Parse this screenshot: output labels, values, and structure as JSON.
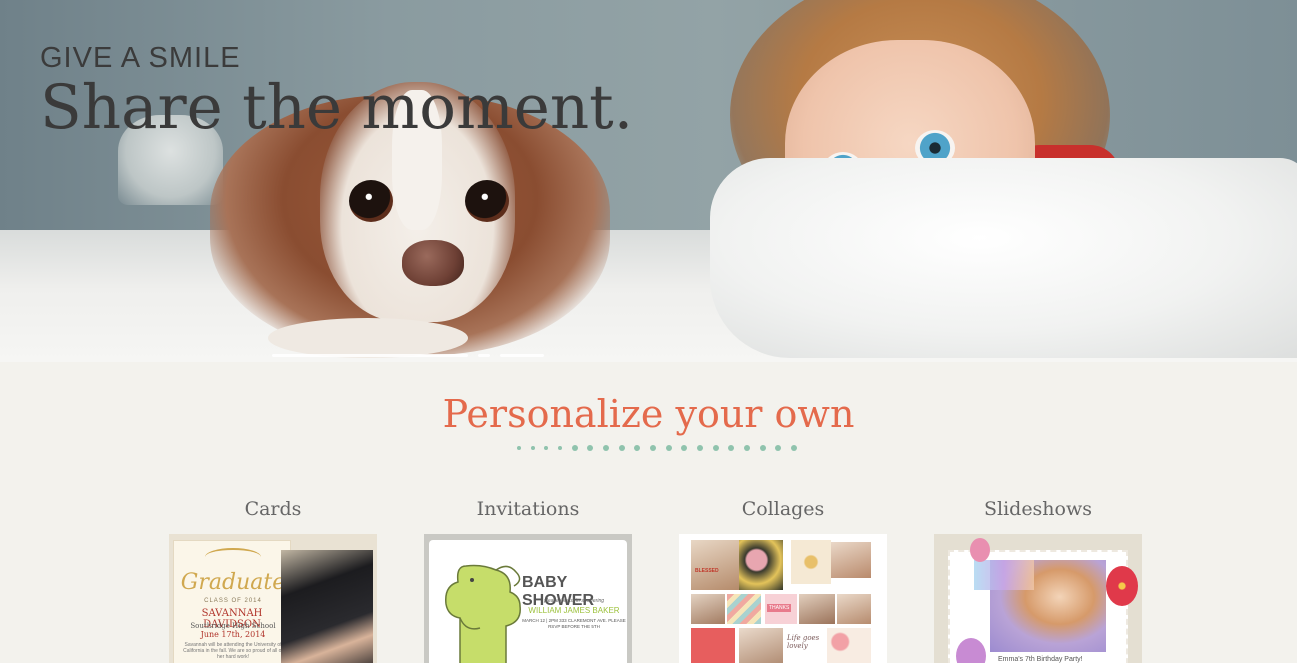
{
  "hero": {
    "eyebrow": "GIVE A SMILE",
    "headline": "Share the moment.",
    "slider_count": 3
  },
  "personalize": {
    "title": "Personalize your own",
    "accent_color": "#e46a4c",
    "dots_color": "#8fc3ad"
  },
  "products": [
    {
      "label": "Cards",
      "thumb": {
        "heading": "Graduate",
        "class_line": "CLASS OF 2014",
        "name": "SAVANNAH DAVIDSON",
        "school": "Southridge High School",
        "date": "June 17th, 2014",
        "fine_print": "Savannah will be attending the University of California in the fall. We are so proud of all of her hard work!"
      }
    },
    {
      "label": "Invitations",
      "thumb": {
        "title": "BABY SHOWER",
        "sub": "please join us in showering",
        "who": "WILLIAM JAMES BAKER",
        "addr": "MARCH 12 | 2PM 333 CLAREMONT AVE. PLEASE RSVP BEFORE THE 5TH"
      }
    },
    {
      "label": "Collages",
      "thumb": {
        "word1": "BLESSED",
        "word2": "THANKS",
        "script": "Life goes lovely"
      }
    },
    {
      "label": "Slideshows",
      "thumb": {
        "caption": "Emma's 7th Birthday Party!"
      }
    }
  ]
}
